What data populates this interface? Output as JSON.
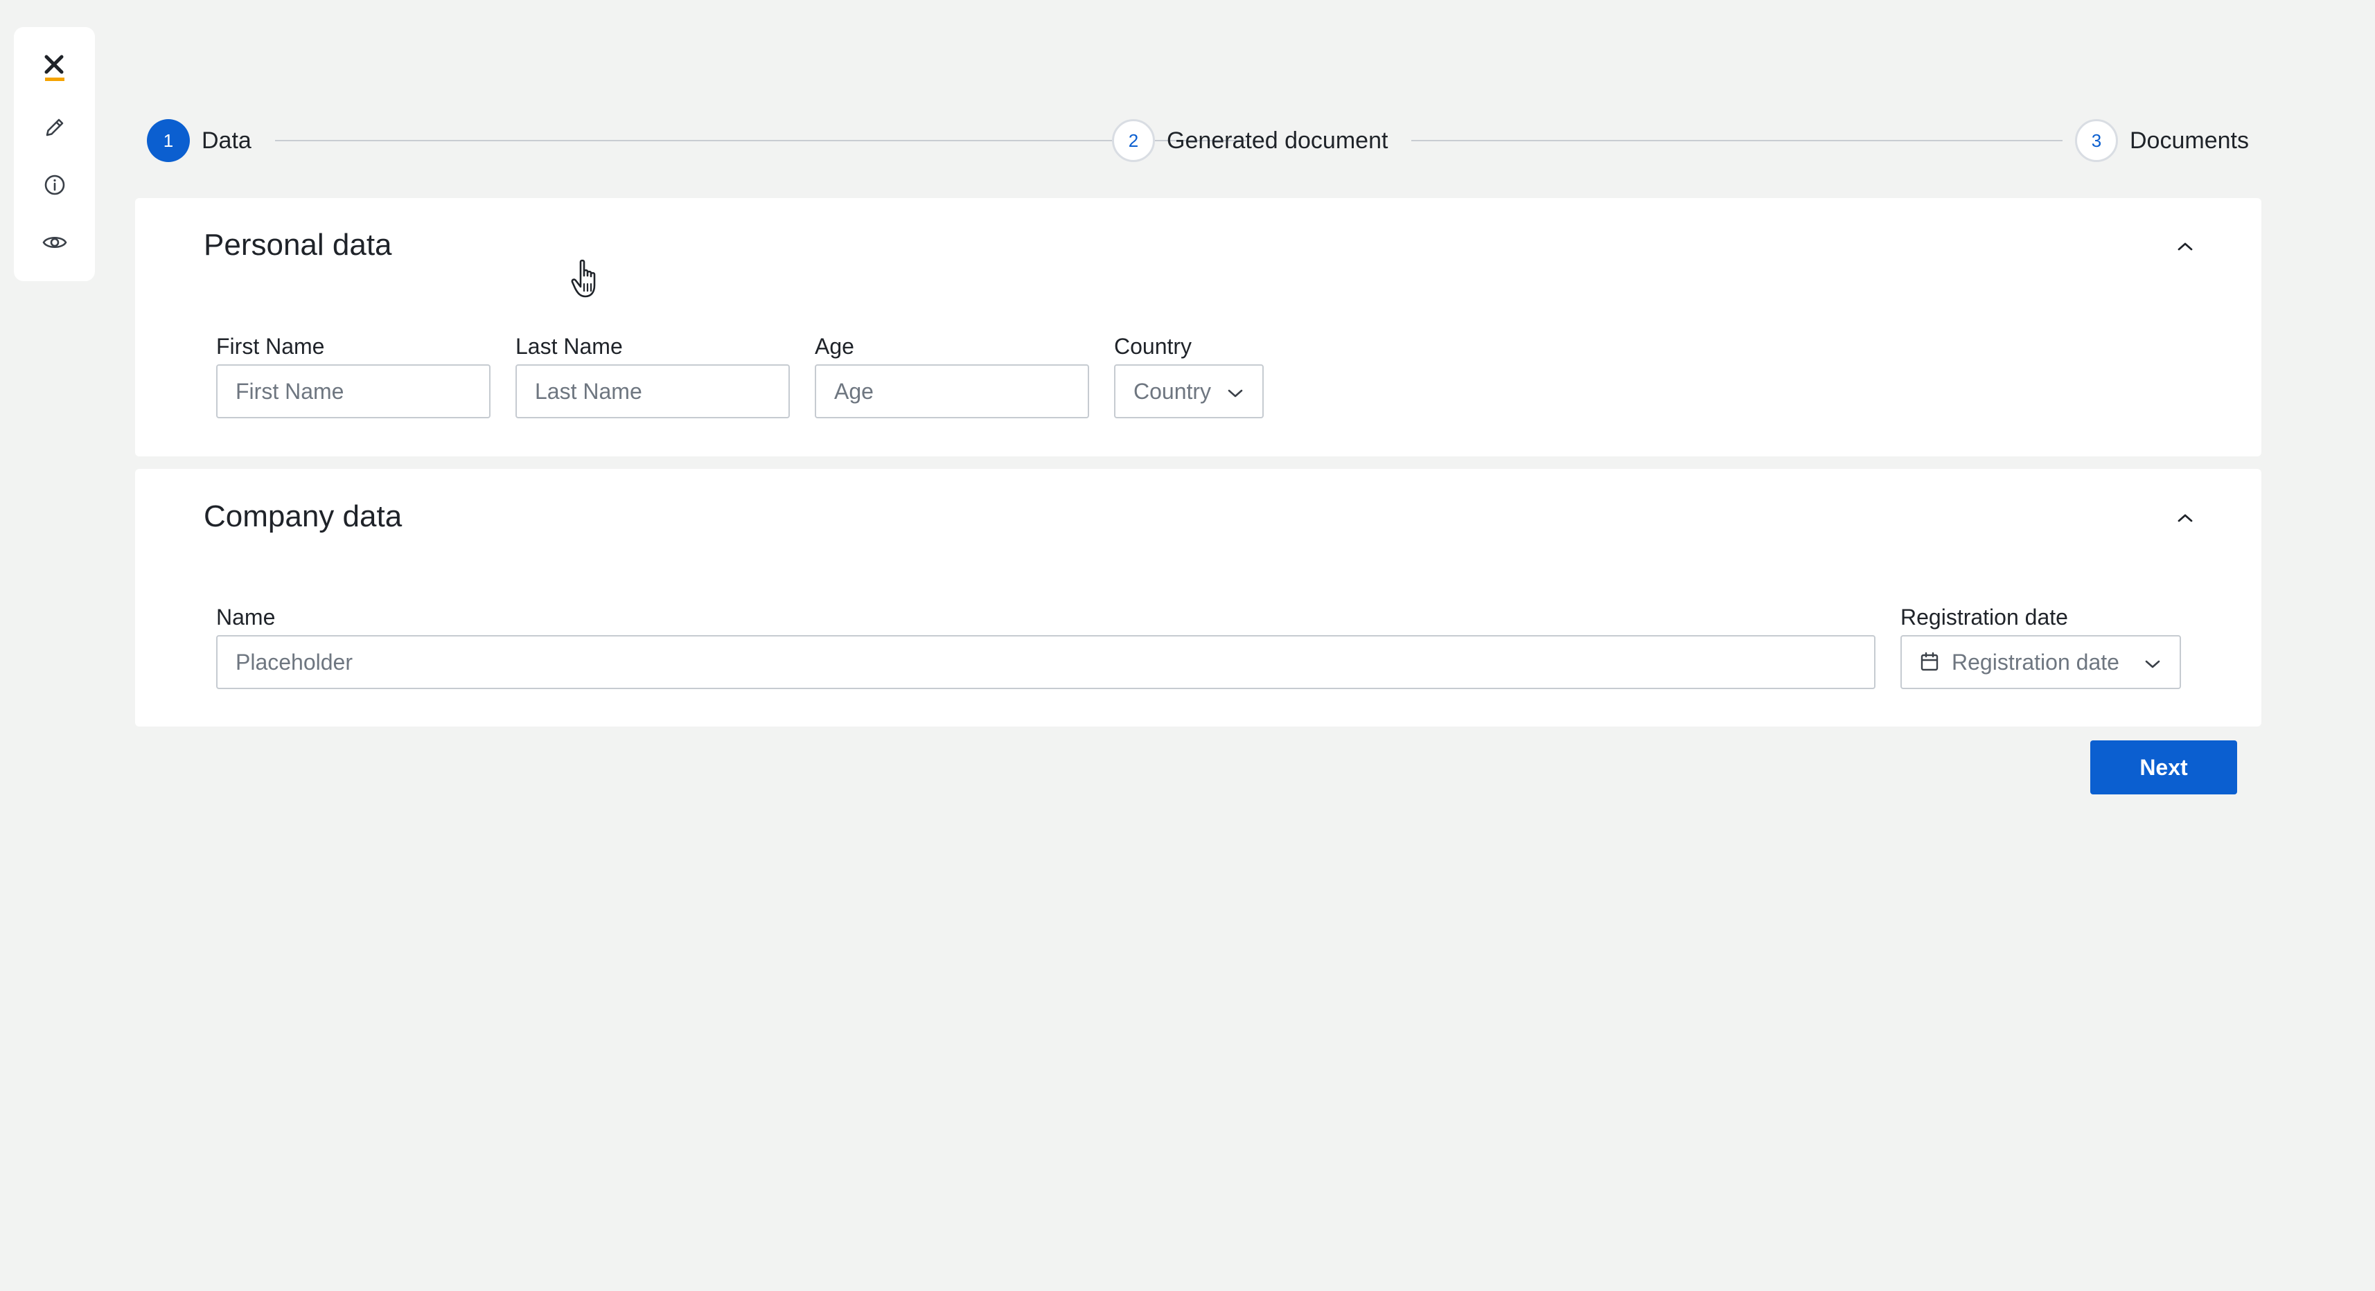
{
  "toolbar": {
    "logo_text": "x",
    "logo_icon": "x-logo-icon",
    "accent_color": "#f5a300",
    "items": [
      {
        "name": "edit",
        "icon": "pencil-icon"
      },
      {
        "name": "info",
        "icon": "info-icon"
      },
      {
        "name": "preview",
        "icon": "eye-icon"
      }
    ]
  },
  "stepper": {
    "active_color": "#0b5fd0",
    "steps": [
      {
        "number": "1",
        "label": "Data",
        "state": "active"
      },
      {
        "number": "2",
        "label": "Generated document",
        "state": "inactive"
      },
      {
        "number": "3",
        "label": "Documents",
        "state": "inactive"
      }
    ]
  },
  "personal": {
    "title": "Personal data",
    "collapse_icon": "chevron-up-icon",
    "fields": {
      "first_name": {
        "label": "First Name",
        "placeholder": "First Name",
        "value": ""
      },
      "last_name": {
        "label": "Last Name",
        "placeholder": "Last Name",
        "value": ""
      },
      "age": {
        "label": "Age",
        "placeholder": "Age",
        "value": ""
      },
      "country": {
        "label": "Country",
        "placeholder": "Country",
        "icon": "chevron-down-icon"
      }
    }
  },
  "company": {
    "title": "Company data",
    "collapse_icon": "chevron-up-icon",
    "fields": {
      "name": {
        "label": "Name",
        "placeholder": "Placeholder",
        "value": ""
      },
      "registration_date": {
        "label": "Registration date",
        "placeholder": "Registration date",
        "icon": "calendar-icon"
      }
    }
  },
  "actions": {
    "next_label": "Next",
    "primary_color": "#0b5fd0"
  }
}
